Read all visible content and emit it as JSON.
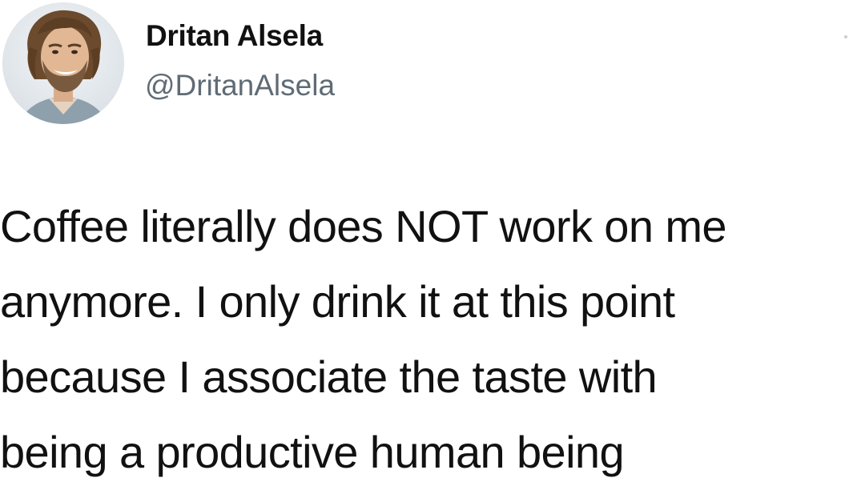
{
  "author": {
    "display_name": "Dritan Alsela",
    "handle": "@DritanAlsela"
  },
  "tweet": {
    "lines": [
      "Coffee literally does NOT work on me",
      "anymore. I only drink it at this point",
      "because I associate the taste with",
      "being a productive human being"
    ]
  },
  "icons": {
    "avatar": "profile-photo",
    "more": "more-options-icon"
  },
  "colors": {
    "name": "#111111",
    "handle": "#5f6b75",
    "text": "#111111"
  }
}
